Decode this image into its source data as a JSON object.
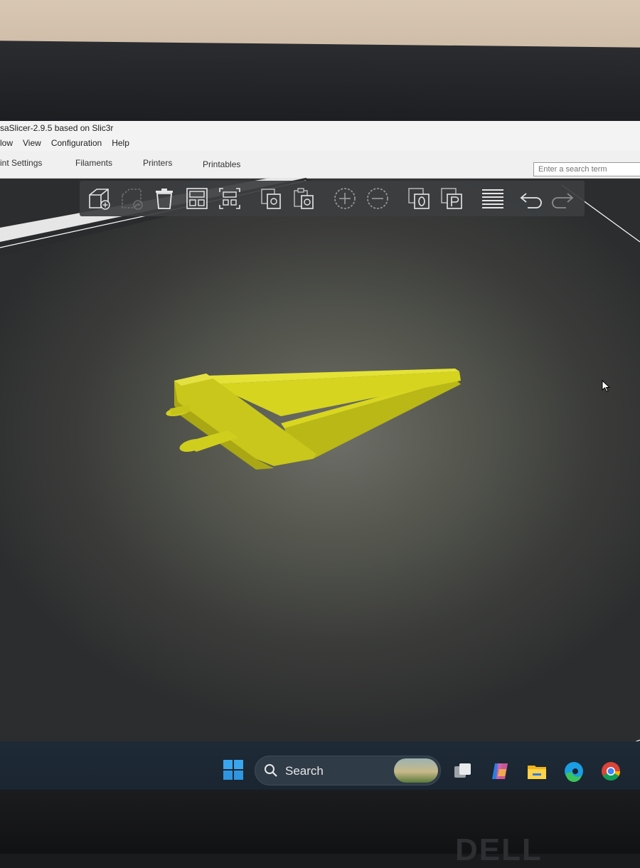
{
  "window": {
    "title": "saSlicer-2.9.5 based on Slic3r"
  },
  "menu": {
    "items": [
      "low",
      "View",
      "Configuration",
      "Help"
    ]
  },
  "tabs": {
    "items": [
      "rint Settings",
      "Filaments",
      "Printers",
      "Printables"
    ]
  },
  "search": {
    "placeholder": "Enter a search term"
  },
  "toolbar": {
    "tools": [
      {
        "icon": "add-object-icon"
      },
      {
        "icon": "delete-object-icon"
      },
      {
        "icon": "delete-all-icon"
      },
      {
        "icon": "arrange-icon"
      },
      {
        "icon": "arrange-selection-icon"
      },
      {
        "icon": "copy-icon"
      },
      {
        "icon": "paste-icon"
      },
      {
        "icon": "add-instance-icon"
      },
      {
        "icon": "remove-instance-icon"
      },
      {
        "icon": "split-to-objects-icon"
      },
      {
        "icon": "split-to-parts-icon"
      },
      {
        "icon": "layer-editing-icon"
      },
      {
        "icon": "undo-icon"
      },
      {
        "icon": "redo-icon"
      }
    ]
  },
  "model": {
    "color": "#d8d820"
  },
  "taskbar": {
    "search_label": "Search",
    "apps": [
      "task-view-icon",
      "copilot-icon",
      "file-explorer-icon",
      "edge-icon",
      "chrome-icon"
    ]
  },
  "hardware": {
    "brand": "DELL"
  }
}
